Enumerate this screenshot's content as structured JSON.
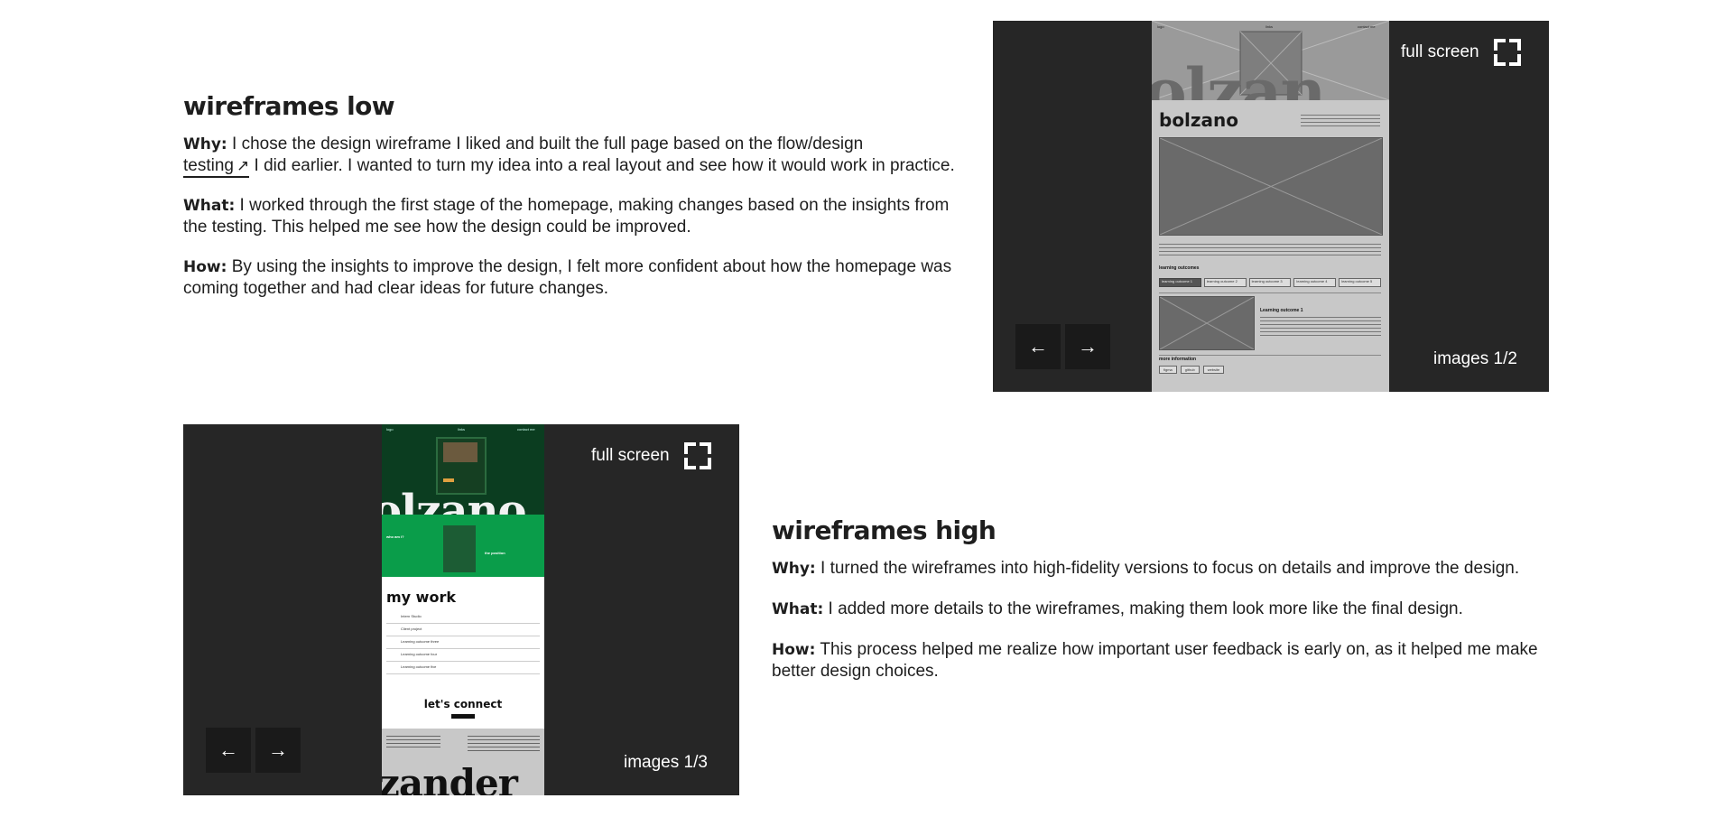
{
  "section_low": {
    "title": "wireframes low",
    "why_label": "Why:",
    "why_text_1": " I chose the design wireframe I liked and built the full page based on the flow/design",
    "why_link": "testing",
    "why_link_arrow": "↗",
    "why_text_2": " I did earlier. I wanted to turn my idea into a real layout and see how it would work in practice.",
    "what_label": "What:",
    "what_text": " I worked through the first stage of the homepage, making changes based on the insights from the testing. This helped me see how the design could be improved.",
    "how_label": "How:",
    "how_text": " By using the insights to improve the design, I felt more confident about how the homepage was coming together and had clear ideas for future changes."
  },
  "viewer_low": {
    "fullscreen_label": "full screen",
    "counter": "images 1/2",
    "prev_arrow": "←",
    "next_arrow": "→",
    "image": {
      "nav_left": "logo",
      "nav_mid": "links",
      "nav_right": "contact me",
      "brand": "bolzano",
      "brand_bg": "olzan",
      "section_heading": "learning outcomes",
      "tabs": [
        "learning outcome 1",
        "learning outcome 2",
        "learning outcome 3",
        "learning outcome 4",
        "learning outcome 5"
      ],
      "card_title": "Learning outcome 1",
      "more_heading": "more information",
      "pills": [
        "figma",
        "github",
        "website"
      ]
    }
  },
  "section_high": {
    "title": "wireframes high",
    "why_label": "Why:",
    "why_text": " I turned the wireframes into high-fidelity versions to focus on details and improve the design.",
    "what_label": "What:",
    "what_text": " I added more details to the wireframes, making them look more like the final design.",
    "how_label": "How:",
    "how_text": " This process helped me realize how important user feedback is early on, as it helped me make better design choices."
  },
  "viewer_high": {
    "fullscreen_label": "full screen",
    "counter": "images 1/3",
    "prev_arrow": "←",
    "next_arrow": "→",
    "image": {
      "nav_left": "logo",
      "nav_mid": "links",
      "nav_right": "contact me",
      "hero_bg": "olzano",
      "who_heading": "who am i?",
      "side_heading": "the position",
      "work_heading": "my work",
      "work_items": [
        "Intern Studio",
        "Client project",
        "Learning outcome three",
        "Learning outcome four",
        "Learning outcome five"
      ],
      "connect_heading": "let's connect",
      "footer_brand": "zander"
    }
  },
  "colors": {
    "dark_panel": "#262626",
    "button_bg": "#1a1a1a",
    "hifi_green": "#0a9d4a",
    "hifi_dark_green": "#0b3d20"
  }
}
